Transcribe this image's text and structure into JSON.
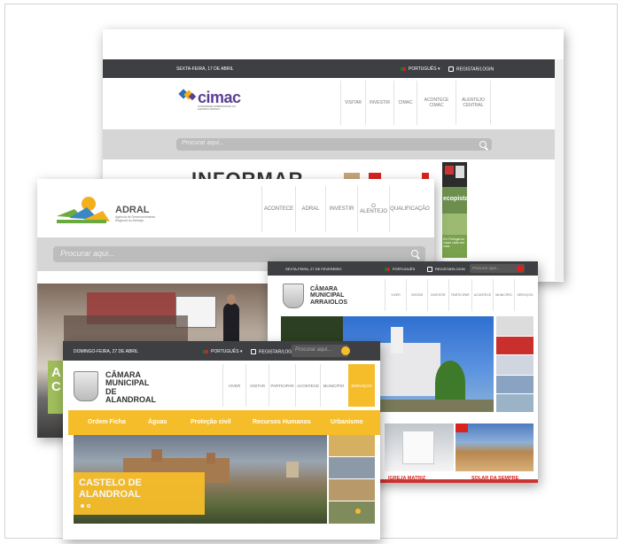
{
  "cimac": {
    "date": "SEXTA-FEIRA, 17 DE ABRIL",
    "language": "PORTUGUÊS",
    "login": "REGISTAR/LOGIN",
    "logo_text": "cimac",
    "logo_subtitle": "COMUNIDADE INTERMUNICIPAL DO ALENTEJO CENTRAL",
    "nav": [
      "VISITAR",
      "INVESTIR",
      "CIMAC",
      "ACONTECE CIMAC",
      "ALENTEJO CENTRAL"
    ],
    "search_placeholder": "Procurar aqui...",
    "headline": "INFORMAR",
    "side_banners": [
      "ecopista",
      "Em Portugal as casas cada vez mais"
    ]
  },
  "adral": {
    "logo_text": "ADRAL",
    "logo_subtitle": "Agência de Desenvolvimento Regional do Alentejo",
    "nav": [
      "ACONTECE",
      "ADRAL",
      "INVESTIR",
      "O ALENTEJO",
      "QUALIFICAÇÃO"
    ],
    "search_placeholder": "Procurar aqui...",
    "slide_letters": "A C"
  },
  "arraiolos": {
    "date": "SEXTA-FEIRA, 27 DE FEVEREIRO",
    "language": "PORTUGUÊS",
    "login": "REGISTAR/LOGIN",
    "search_placeholder": "Procurar aqui...",
    "title": [
      "CÂMARA",
      "MUNICIPAL",
      "ARRAIOLOS"
    ],
    "nav": [
      "VIVER",
      "VISITAR",
      "INVESTIR",
      "PARTICIPAR",
      "ACONTECE",
      "MUNICÍPIO",
      "SERVIÇOS"
    ],
    "cards": [
      "IGREJA MATRIZ",
      "SOLAR DA SEMPRE"
    ]
  },
  "alandroal": {
    "date": "DOMINGO-FEIRA, 27 DE ABRIL",
    "language": "PORTUGUÊS",
    "login": "REGISTAR/LOGIN",
    "search_placeholder": "Procurar aqui...",
    "title": [
      "CÂMARA",
      "MUNICIPAL",
      "DE",
      "ALANDROAL"
    ],
    "nav": [
      "VIVER",
      "VISITAR",
      "PARTICIPAR",
      "ACONTECE",
      "MUNICÍPIO",
      "SERVIÇOS"
    ],
    "yellow_nav": [
      "Ordem Ficha",
      "Águas",
      "Proteção civil",
      "Recursos Humanos",
      "Urbanismo"
    ],
    "hero_title": [
      "CASTELO DE",
      "ALANDROAL"
    ]
  },
  "colors": {
    "topbar": "#3d3f42",
    "yellow": "#f6bd2a",
    "red": "#d8241f",
    "cimac_purple": "#5b3e94"
  }
}
